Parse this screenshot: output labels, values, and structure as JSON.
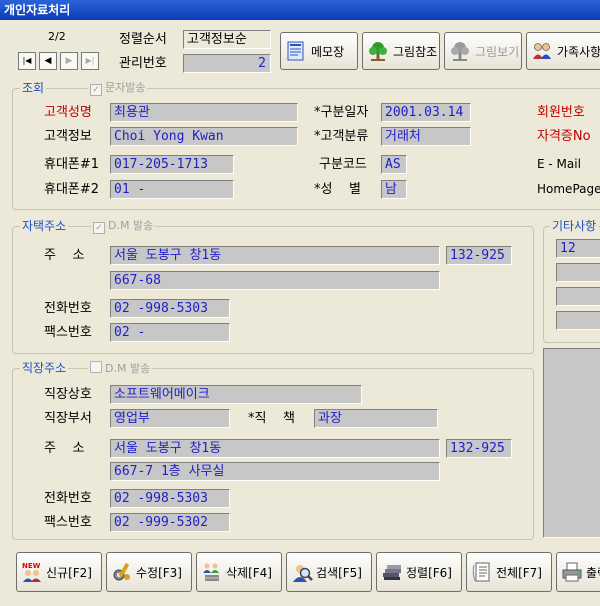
{
  "window": {
    "title": "개인자료처리"
  },
  "nav": {
    "record_counter": "2/2",
    "first": "|◀",
    "prev": "◀",
    "next": "▶",
    "last": "▶|"
  },
  "sort": {
    "label": "정렬순서",
    "value": "고객정보순"
  },
  "mgmt": {
    "label": "관리번호",
    "value": "2"
  },
  "toolbar": [
    {
      "label": "메모장",
      "icon": "memo-icon",
      "enabled": true
    },
    {
      "label": "그림참조",
      "icon": "tree-icon",
      "enabled": true
    },
    {
      "label": "그림보기",
      "icon": "tree-icon",
      "enabled": false
    },
    {
      "label": "가족사항",
      "icon": "family-icon",
      "enabled": true
    }
  ],
  "lookup": {
    "title": "조회",
    "sms_check": {
      "label": "문자발송",
      "checked": true
    },
    "customer_name": {
      "label": "고객성명",
      "value": "최용관"
    },
    "customer_info": {
      "label": "고객정보",
      "value": "Choi Yong Kwan"
    },
    "mobile1": {
      "label": "휴대폰#1",
      "value": "017-205-1713"
    },
    "mobile2": {
      "label": "휴대폰#2",
      "value": "01 -"
    },
    "reg_date": {
      "label": "*구분일자",
      "value": "2001.03.14"
    },
    "category": {
      "label": "*고객분류",
      "value": "거래처"
    },
    "code": {
      "label": "구분코드",
      "value": "AS"
    },
    "gender": {
      "label": "*성    별",
      "value": "남"
    },
    "member_no": {
      "label": "회원번호"
    },
    "license_no": {
      "label": "자격증No"
    },
    "email": {
      "label": "E - Mail"
    },
    "homepage": {
      "label": "HomePage"
    }
  },
  "home": {
    "title": "자택주소",
    "dm_check": {
      "label": "D.M 발송",
      "checked": true
    },
    "address_label": "주    소",
    "address1": "서울 도봉구 창1동",
    "zip": "132-925",
    "address2": "667-68",
    "phone": {
      "label": "전화번호",
      "value": "02  -998-5303"
    },
    "fax": {
      "label": "팩스번호",
      "value": "02  -"
    }
  },
  "other": {
    "title": "기타사항",
    "values": [
      "12",
      "",
      "",
      ""
    ]
  },
  "work": {
    "title": "직장주소",
    "dm_check": {
      "label": "D.M 발송",
      "checked": false
    },
    "company": {
      "label": "직장상호",
      "value": "소프트웨어메이크"
    },
    "dept": {
      "label": "직장부서",
      "value": "영업부"
    },
    "position": {
      "label": "*직    책",
      "value": "과장"
    },
    "address_label": "주    소",
    "address1": "서울 도봉구 창1동",
    "zip": "132-925",
    "address2": "667-7 1층 사무실",
    "phone": {
      "label": "전화번호",
      "value": "02  -998-5303"
    },
    "fax": {
      "label": "팩스번호",
      "value": "02  -999-5302"
    }
  },
  "actions": [
    {
      "label": "신규[F2]",
      "icon": "new-icon"
    },
    {
      "label": "수정[F3]",
      "icon": "edit-icon"
    },
    {
      "label": "삭제[F4]",
      "icon": "delete-icon"
    },
    {
      "label": "검색[F5]",
      "icon": "search-icon"
    },
    {
      "label": "정렬[F6]",
      "icon": "sort-icon"
    },
    {
      "label": "전체[F7]",
      "icon": "list-icon"
    },
    {
      "label": "출력",
      "icon": "print-icon"
    }
  ]
}
